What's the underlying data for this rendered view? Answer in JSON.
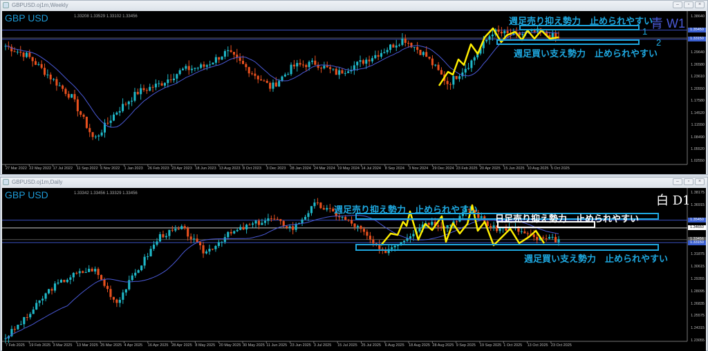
{
  "weekly": {
    "window_title": "GBPUSD.oj1m,Weekly",
    "symbol": "GBP USD",
    "ohlc": "1.33208 1.33529 1.33102 1.33456",
    "timeframe_label": "青 W1",
    "annotation_resistance": "週足売り抑え勢力　止められやすい",
    "annotation_support": "週足買い支え勢力　止められやすい",
    "zone_labels": [
      "1",
      "2"
    ],
    "price_range": [
      1.0255,
      1.3864
    ],
    "price_labels": [
      "1.38640",
      "1.29640",
      "1.26580",
      "1.23610",
      "1.20550",
      "1.17580",
      "1.14520",
      "1.11550",
      "1.08490",
      "1.05520",
      "1.02550"
    ],
    "price_tags": [
      "1.35450",
      "1.33150"
    ],
    "date_labels": [
      "27 Mar 2022",
      "22 May 2022",
      "17 Jul 2022",
      "11 Sep 2022",
      "6 Nov 2022",
      "1 Jan 2023",
      "26 Feb 2023",
      "23 Apr 2023",
      "18 Jun 2023",
      "13 Aug 2023",
      "8 Oct 2023",
      "3 Dec 2023",
      "28 Jan 2024",
      "24 Mar 2024",
      "19 May 2024",
      "14 Jul 2024",
      "8 Sep 2024",
      "3 Nov 2024",
      "29 Dec 2024",
      "23 Feb 2025",
      "20 Apr 2025",
      "15 Jun 2025",
      "10 Aug 2025",
      "5 Oct 2025"
    ],
    "close_anchors": [
      1.315,
      1.29,
      1.238,
      1.186,
      1.08,
      1.15,
      1.2,
      1.22,
      1.255,
      1.264,
      1.3,
      1.255,
      1.21,
      1.264,
      1.272,
      1.246,
      1.272,
      1.3,
      1.333,
      1.29,
      1.22,
      1.272,
      1.35,
      1.341,
      1.35,
      1.334
    ]
  },
  "daily": {
    "window_title": "GBPUSD.oj1m,Daily",
    "symbol": "GBP USD",
    "ohlc": "1.33342 1.33456 1.33329 1.33456",
    "timeframe_label": "白 D1",
    "annotation_weekly_resistance": "週足売り抑え勢力　止められやすい",
    "annotation_daily_resistance": "日足売り抑え勢力　止められやすい",
    "annotation_weekly_support": "週足買い支え勢力　止められやすい",
    "price_range": [
      1.23055,
      1.38175
    ],
    "price_labels": [
      "1.38175",
      "1.36915",
      "1.31875",
      "1.30615",
      "1.29355",
      "1.28095",
      "1.26835",
      "1.25575",
      "1.24315",
      "1.23055"
    ],
    "price_tags": [
      "1.35450",
      "1.34650",
      "1.33456",
      "1.33150"
    ],
    "date_labels": [
      "7 Feb 2025",
      "19 Feb 2025",
      "3 Mar 2025",
      "13 Mar 2025",
      "25 Mar 2025",
      "4 Apr 2025",
      "16 Apr 2025",
      "28 Apr 2025",
      "8 May 2025",
      "20 May 2025",
      "30 May 2025",
      "11 Jun 2025",
      "23 Jun 2025",
      "3 Jul 2025",
      "15 Jul 2025",
      "25 Jul 2025",
      "6 Aug 2025",
      "18 Aug 2025",
      "28 Aug 2025",
      "9 Sep 2025",
      "19 Sep 2025",
      "1 Oct 2025",
      "13 Oct 2025",
      "23 Oct 2025"
    ],
    "close_anchors": [
      1.2346,
      1.256,
      1.284,
      1.298,
      1.305,
      1.27,
      1.305,
      1.339,
      1.346,
      1.321,
      1.339,
      1.349,
      1.356,
      1.346,
      1.371,
      1.36,
      1.346,
      1.321,
      1.335,
      1.353,
      1.349,
      1.367,
      1.346,
      1.346,
      1.335,
      1.3345
    ]
  },
  "colors": {
    "bull": "#1fb8c8",
    "bear": "#e8501e",
    "ma": "#4a5ad8",
    "zigzag": "#ffee00",
    "zone": "#1ea8e0"
  }
}
